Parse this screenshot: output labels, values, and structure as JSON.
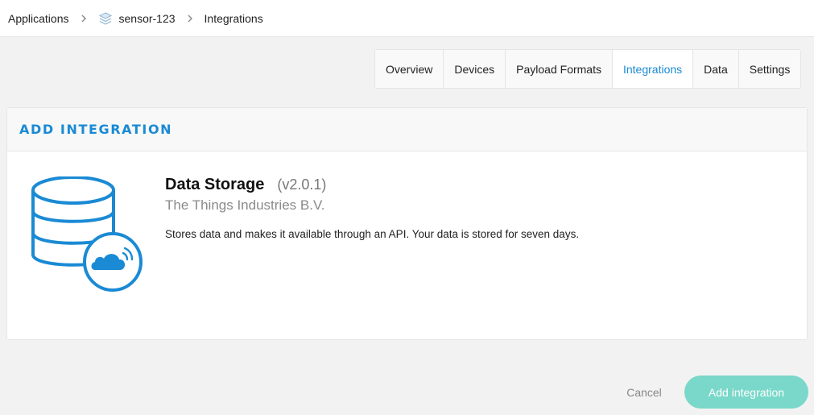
{
  "breadcrumb": {
    "items": [
      {
        "label": "Applications",
        "icon": ""
      },
      {
        "label": "sensor-123",
        "icon": "layers-icon"
      },
      {
        "label": "Integrations",
        "icon": ""
      }
    ],
    "separator_icon": "chevron-right-icon"
  },
  "tabs": [
    {
      "label": "Overview",
      "active": false
    },
    {
      "label": "Devices",
      "active": false
    },
    {
      "label": "Payload Formats",
      "active": false
    },
    {
      "label": "Integrations",
      "active": true
    },
    {
      "label": "Data",
      "active": false
    },
    {
      "label": "Settings",
      "active": false
    }
  ],
  "card": {
    "title": "ADD INTEGRATION",
    "integration": {
      "name": "Data Storage",
      "version": "(v2.0.1)",
      "vendor": "The Things Industries B.V.",
      "description": "Stores data and makes it available through an API. Your data is stored for seven days.",
      "icon": "database-cloud-icon"
    }
  },
  "actions": {
    "cancel_label": "Cancel",
    "submit_label": "Add integration"
  },
  "colors": {
    "accent": "#1a8ad4",
    "submit_button": "#79d8c9",
    "background": "#f2f2f2"
  }
}
